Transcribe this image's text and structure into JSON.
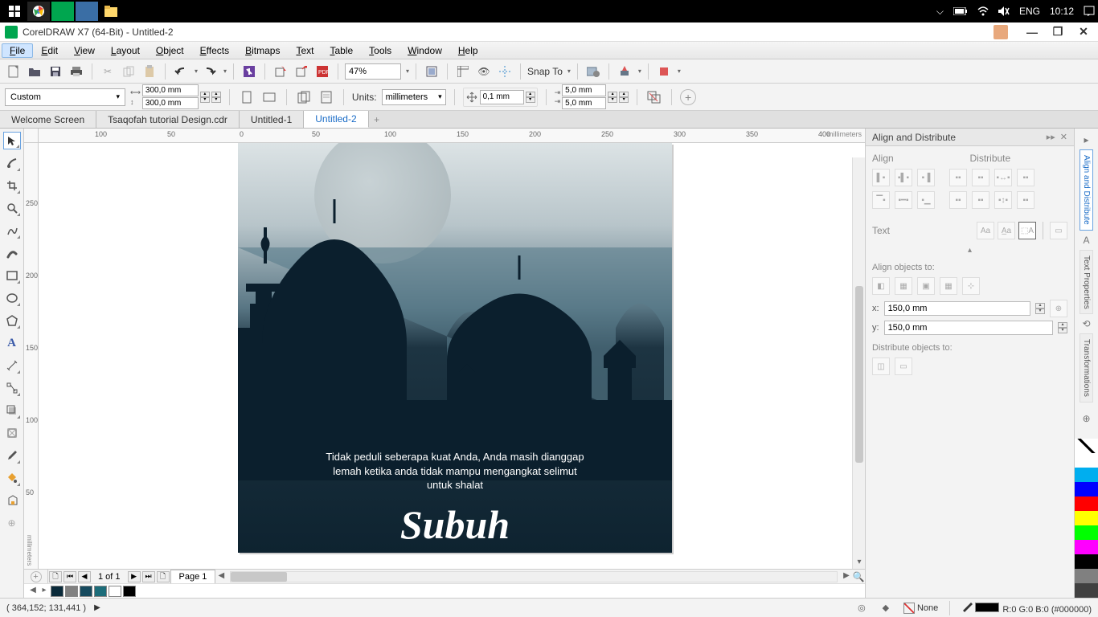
{
  "taskbar": {
    "lang": "ENG",
    "time": "10:12"
  },
  "title": "CorelDRAW X7 (64-Bit) - Untitled-2",
  "menu": [
    "File",
    "Edit",
    "View",
    "Layout",
    "Object",
    "Effects",
    "Bitmaps",
    "Text",
    "Table",
    "Tools",
    "Window",
    "Help"
  ],
  "active_menu": "File",
  "toolbar": {
    "zoom": "47%",
    "snap": "Snap To"
  },
  "propbar": {
    "preset": "Custom",
    "width": "300,0 mm",
    "height": "300,0 mm",
    "units_label": "Units:",
    "units": "millimeters",
    "nudge": "0,1 mm",
    "dup_x": "5,0 mm",
    "dup_y": "5,0 mm"
  },
  "doc_tabs": [
    "Welcome Screen",
    "Tsaqofah tutorial Design.cdr",
    "Untitled-1",
    "Untitled-2"
  ],
  "active_doc": "Untitled-2",
  "ruler": {
    "h_ticks": [
      {
        "p": 70,
        "l": "100"
      },
      {
        "p": 160,
        "l": "50"
      },
      {
        "p": 250,
        "l": "0"
      },
      {
        "p": 340,
        "l": "50"
      },
      {
        "p": 430,
        "l": "100"
      },
      {
        "p": 520,
        "l": "150"
      },
      {
        "p": 610,
        "l": "200"
      },
      {
        "p": 700,
        "l": "250"
      },
      {
        "p": 790,
        "l": "300"
      },
      {
        "p": 880,
        "l": "350"
      },
      {
        "p": 970,
        "l": "400"
      }
    ],
    "h_units": "millimeters",
    "v_ticks": [
      {
        "p": 70,
        "l": "250"
      },
      {
        "p": 160,
        "l": "200"
      },
      {
        "p": 250,
        "l": "150"
      },
      {
        "p": 340,
        "l": "100"
      },
      {
        "p": 430,
        "l": "50"
      }
    ],
    "v_units": "millimeters"
  },
  "art": {
    "line1": "Tidak peduli seberapa kuat Anda, Anda masih dianggap",
    "line2": "lemah ketika anda tidak mampu mengangkat selimut",
    "line3": "untuk shalat",
    "script": "Subuh"
  },
  "docker": {
    "title": "Align and Distribute",
    "align": "Align",
    "distribute": "Distribute",
    "text": "Text",
    "align_to": "Align objects to:",
    "coord_x_label": "x:",
    "coord_x": "150,0 mm",
    "coord_y_label": "y:",
    "coord_y": "150,0 mm",
    "dist_to": "Distribute objects to:"
  },
  "side_tabs": [
    "Align and Distribute",
    "Text Properties",
    "Transformations"
  ],
  "palette": [
    "#ffffff",
    "#00aeef",
    "#0000ff",
    "#ff0000",
    "#ffff00",
    "#00ff00",
    "#ff00ff",
    "#000000",
    "#808080",
    "#404040"
  ],
  "page_nav": {
    "of": "1 of 1",
    "page": "Page 1"
  },
  "doc_palette": [
    "#0a2a3a",
    "#808080",
    "#164a5e",
    "#1d6d7a",
    "#ffffff",
    "#000000"
  ],
  "status": {
    "coords": "( 364,152; 131,441 )",
    "fill_label": "None",
    "color": "R:0 G:0 B:0 (#000000)"
  }
}
